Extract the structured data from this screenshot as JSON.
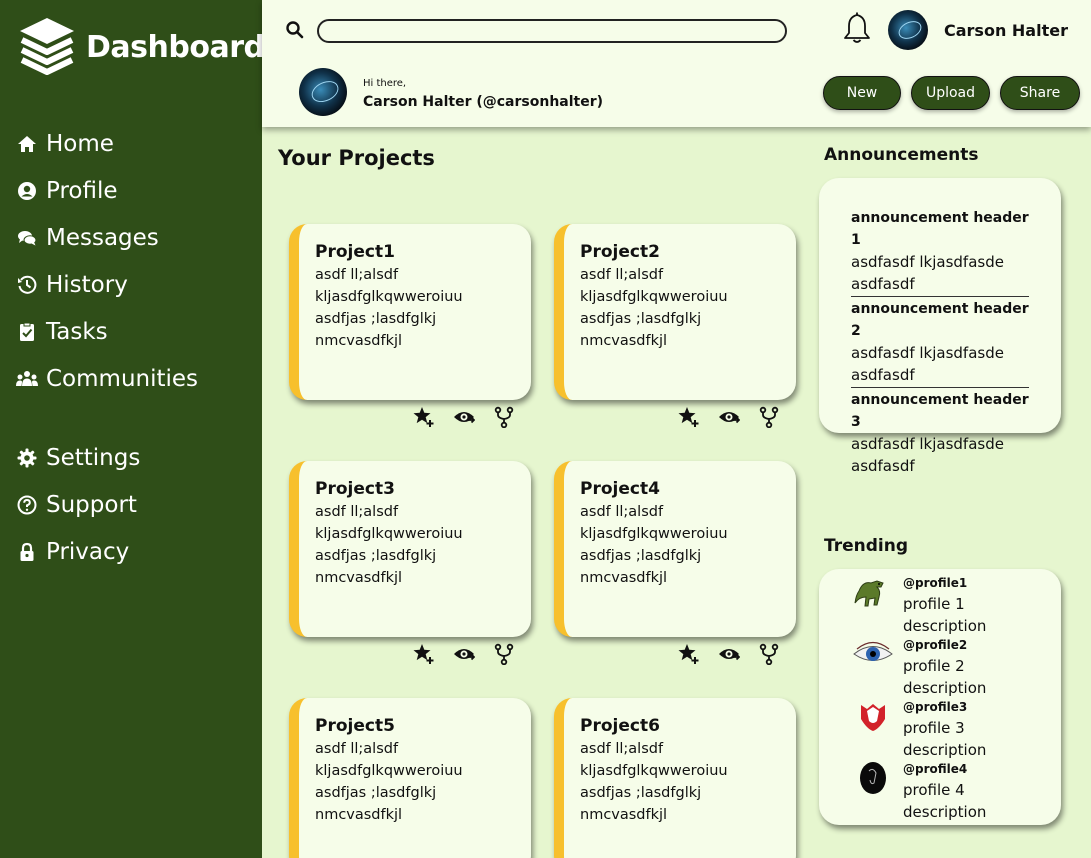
{
  "brand": {
    "title": "Dashboard"
  },
  "nav": {
    "primary": [
      {
        "label": "Home",
        "icon": "home-icon"
      },
      {
        "label": "Profile",
        "icon": "profile-icon"
      },
      {
        "label": "Messages",
        "icon": "messages-icon"
      },
      {
        "label": "History",
        "icon": "history-icon"
      },
      {
        "label": "Tasks",
        "icon": "tasks-icon"
      },
      {
        "label": "Communities",
        "icon": "communities-icon"
      }
    ],
    "secondary": [
      {
        "label": "Settings",
        "icon": "gear-icon"
      },
      {
        "label": "Support",
        "icon": "help-icon"
      },
      {
        "label": "Privacy",
        "icon": "lock-icon"
      }
    ]
  },
  "header": {
    "search": {
      "placeholder": ""
    },
    "user_name": "Carson Halter",
    "greeting_small": "Hi there,",
    "greeting_name": "Carson Halter (@carsonhalter)",
    "buttons": {
      "new": "New",
      "upload": "Upload",
      "share": "Share"
    }
  },
  "projects": {
    "title": "Your Projects",
    "items": [
      {
        "name": "Project1",
        "lines": [
          "asdf ll;alsdf",
          "kljasdfglkqwweroiuu",
          "asdfjas ;lasdfglkj",
          "nmcvasdfkjl"
        ]
      },
      {
        "name": "Project2",
        "lines": [
          "asdf ll;alsdf",
          "kljasdfglkqwweroiuu",
          "asdfjas ;lasdfglkj",
          "nmcvasdfkjl"
        ]
      },
      {
        "name": "Project3",
        "lines": [
          "asdf ll;alsdf",
          "kljasdfglkqwweroiuu",
          "asdfjas ;lasdfglkj",
          "nmcvasdfkjl"
        ]
      },
      {
        "name": "Project4",
        "lines": [
          "asdf ll;alsdf",
          "kljasdfglkqwweroiuu",
          "asdfjas ;lasdfglkj",
          "nmcvasdfkjl"
        ]
      },
      {
        "name": "Project5",
        "lines": [
          "asdf ll;alsdf",
          "kljasdfglkqwweroiuu",
          "asdfjas ;lasdfglkj",
          "nmcvasdfkjl"
        ]
      },
      {
        "name": "Project6",
        "lines": [
          "asdf ll;alsdf",
          "kljasdfglkqwweroiuu",
          "asdfjas ;lasdfglkj",
          "nmcvasdfkjl"
        ]
      }
    ],
    "action_icons": [
      "star-add-icon",
      "watch-icon",
      "fork-icon"
    ]
  },
  "announcements": {
    "title": "Announcements",
    "items": [
      {
        "header": "announcement header 1",
        "text": "asdfasdf lkjasdfasde asdfasdf"
      },
      {
        "header": "announcement header 2",
        "text": "asdfasdf lkjasdfasde asdfasdf"
      },
      {
        "header": "announcement header 3",
        "text": "asdfasdf lkjasdfasde asdfasdf"
      }
    ]
  },
  "trending": {
    "title": "Trending",
    "items": [
      {
        "handle": "@profile1",
        "description": "profile 1 description",
        "image": "dinosaur-image"
      },
      {
        "handle": "@profile2",
        "description": "profile 2 description",
        "image": "eye-image"
      },
      {
        "handle": "@profile3",
        "description": "profile 3 description",
        "image": "flag-image"
      },
      {
        "handle": "@profile4",
        "description": "profile 4 description",
        "image": "dark-figure-image"
      }
    ]
  },
  "colors": {
    "sidebar": "#2f4e18",
    "background": "#e6f6cf",
    "card": "#f6fde9",
    "accent": "#f7c02d"
  }
}
